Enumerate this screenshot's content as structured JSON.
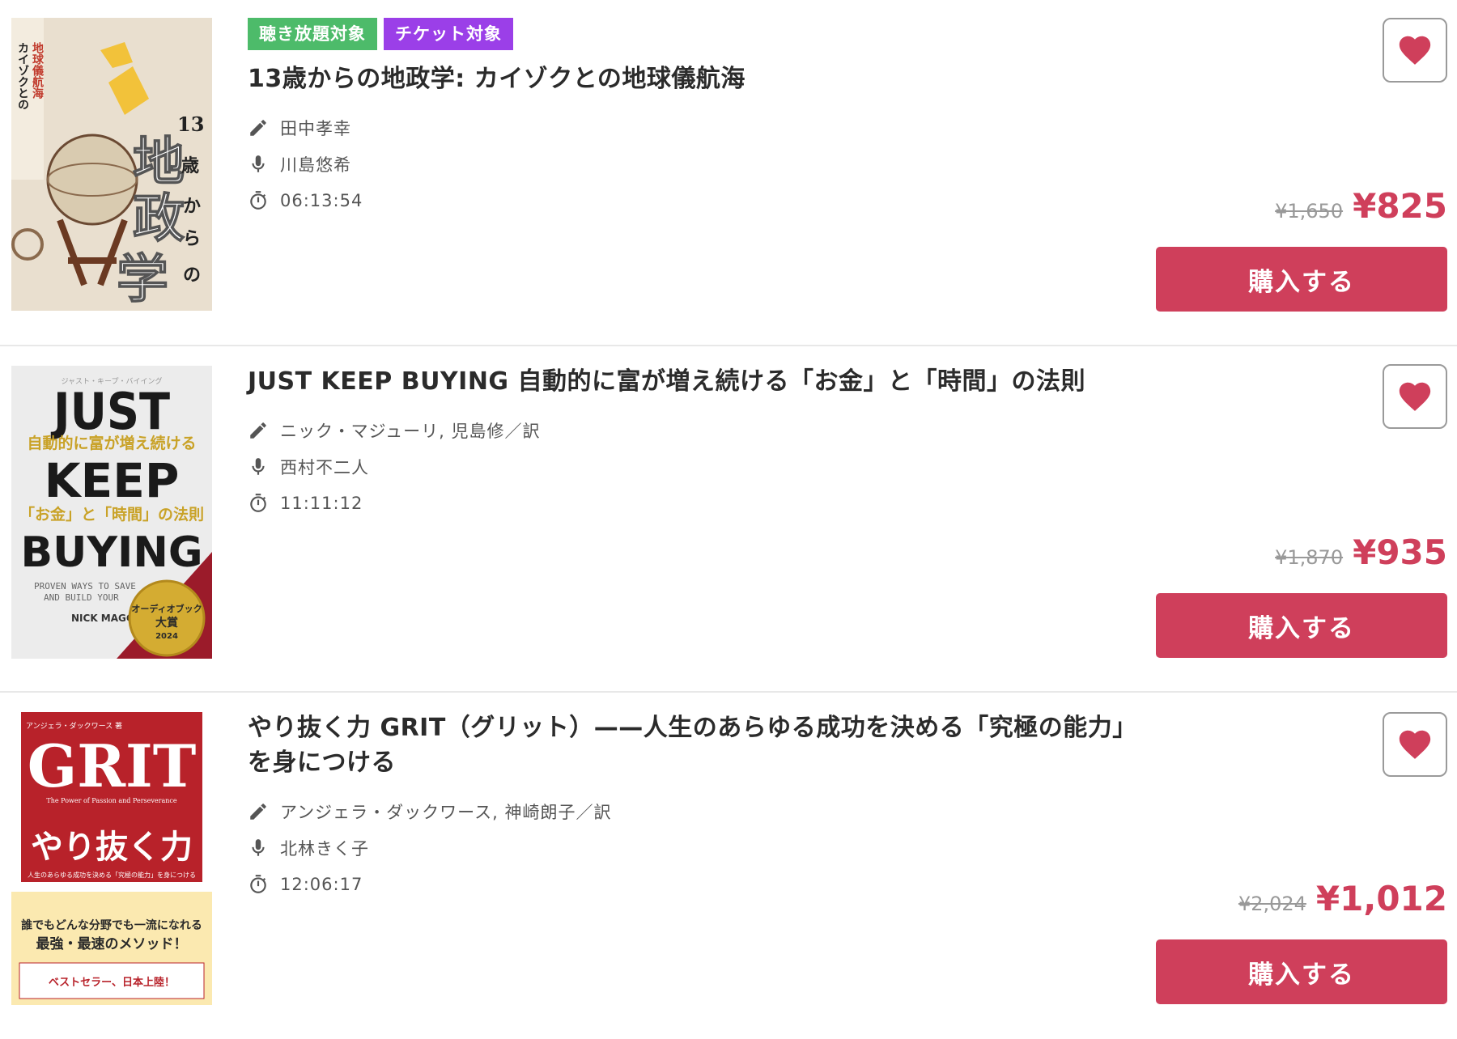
{
  "items": [
    {
      "badges": [
        "聴き放題対象",
        "チケット対象"
      ],
      "title": "13歳からの地政学: カイゾクとの地球儀航海",
      "author": "田中孝幸",
      "narrator": "川島悠希",
      "duration": "06:13:54",
      "original_price": "¥1,650",
      "sale_price": "¥825",
      "buy_label": "購入する",
      "cover": {
        "big_text": "地政学",
        "side_text": "13歳からの",
        "label": "カイゾクとの地球儀航海"
      }
    },
    {
      "badges": [],
      "title": "JUST KEEP BUYING 自動的に富が増え続ける「お金」と「時間」の法則",
      "author": "ニック・マジューリ, 児島修／訳",
      "narrator": "西村不二人",
      "duration": "11:11:12",
      "original_price": "¥1,870",
      "sale_price": "¥935",
      "buy_label": "購入する",
      "cover": {
        "line1": "JUST",
        "line2": "KEEP",
        "line3": "BUYING",
        "sub1": "自動的に富が増え続ける",
        "sub2": "「お金」と「時間」の法則",
        "eng1": "PROVEN WAYS TO SAVE",
        "eng2": "AND BUILD YOUR",
        "author": "NICK MAGGI",
        "award1": "オーディオブック",
        "award2": "大賞",
        "award3": "2024"
      }
    },
    {
      "badges": [],
      "title": "やり抜く力 GRIT（グリット）——人生のあらゆる成功を決める「究極の能力」を身につける",
      "author": "アンジェラ・ダックワース, 神崎朗子／訳",
      "narrator": "北林きく子",
      "duration": "12:06:17",
      "original_price": "¥2,024",
      "sale_price": "¥1,012",
      "buy_label": "購入する",
      "cover": {
        "top": "アンジェラ・ダックワース 著",
        "big": "GRIT",
        "sub": "The Power of Passion and Perseverance",
        "jp": "やり抜く力",
        "tag": "人生のあらゆる成功を決める「究極の能力」を身につける",
        "blurb1": "誰でもどんな分野でも一流になれる",
        "blurb2": "最強・最速のメソッド！",
        "blurb3": "ベストセラー、日本上陸！"
      }
    }
  ],
  "colors": {
    "accent": "#cf3f5b",
    "badge_green": "#4dbb6a",
    "badge_purple": "#9b3fe8"
  }
}
